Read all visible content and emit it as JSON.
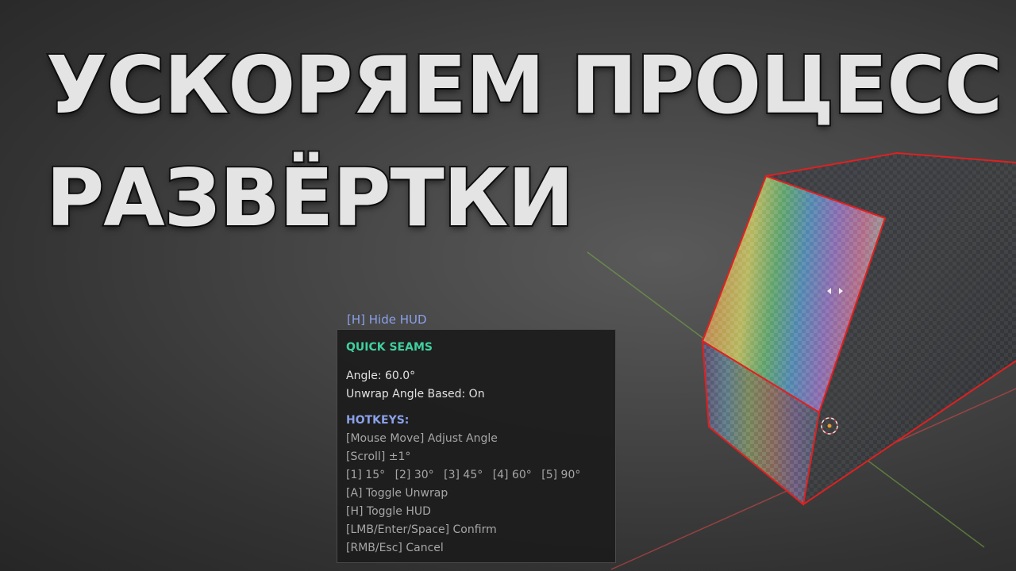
{
  "headline": {
    "line1": "УСКОРЯЕМ ПРОЦЕСС",
    "line2": "РАЗВЁРТКИ"
  },
  "hud": {
    "hide_hud_label": "[H] Hide HUD",
    "title": "QUICK SEAMS",
    "angle_line": "Angle: 60.0°",
    "unwrap_line": "Unwrap Angle Based: On",
    "hotkeys_title": "HOTKEYS:",
    "hotkeys": {
      "mouse_move": "[Mouse Move] Adjust Angle",
      "scroll": "[Scroll] ±1°",
      "presets": [
        "[1] 15°",
        "[2] 30°",
        "[3] 45°",
        "[4] 60°",
        "[5] 90°"
      ],
      "toggle_unwrap": "[A] Toggle Unwrap",
      "toggle_hud": "[H] Toggle HUD",
      "confirm": "[LMB/Enter/Space] Confirm",
      "cancel": "[RMB/Esc] Cancel"
    }
  },
  "colors": {
    "hud_title": "#3fd0a0",
    "hud_accent": "#8aa0e8",
    "mesh_edge": "#e02020",
    "axis_x": "#c04545",
    "axis_y": "#7ab045",
    "cursor": "#e89a2a"
  },
  "icons": {
    "gizmo": "resize-arrows-icon",
    "cursor": "3d-cursor-icon"
  }
}
